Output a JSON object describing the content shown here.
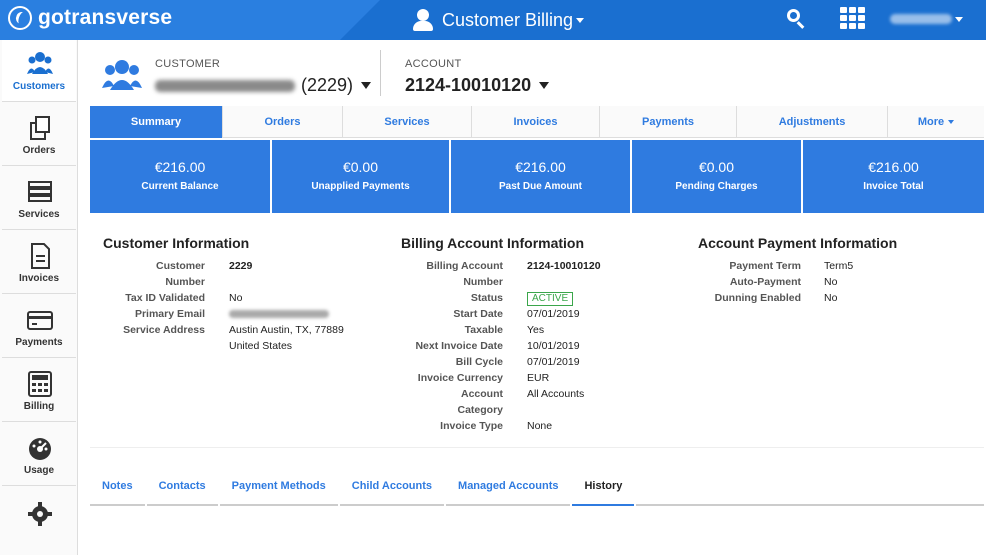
{
  "app": {
    "logo_text": "gotransverse",
    "title": "Customer Billing"
  },
  "topbar": {
    "search_icon": "search-icon",
    "apps_icon": "grid-icon"
  },
  "leftnav": {
    "items": [
      {
        "label": "Customers",
        "icon": "customers-icon"
      },
      {
        "label": "Orders",
        "icon": "orders-icon"
      },
      {
        "label": "Services",
        "icon": "services-icon"
      },
      {
        "label": "Invoices",
        "icon": "invoices-icon"
      },
      {
        "label": "Payments",
        "icon": "payments-icon"
      },
      {
        "label": "Billing",
        "icon": "billing-icon"
      },
      {
        "label": "Usage",
        "icon": "usage-icon"
      },
      {
        "label": "",
        "icon": "settings-icon"
      }
    ]
  },
  "header": {
    "customer_label": "CUSTOMER",
    "customer_id": "(2229)",
    "account_label": "ACCOUNT",
    "account_number": "2124-10010120"
  },
  "tabs": [
    "Summary",
    "Orders",
    "Services",
    "Invoices",
    "Payments",
    "Adjustments",
    "More"
  ],
  "summary": [
    {
      "amount": "€216.00",
      "label": "Current Balance"
    },
    {
      "amount": "€0.00",
      "label": "Unapplied Payments"
    },
    {
      "amount": "€216.00",
      "label": "Past Due Amount"
    },
    {
      "amount": "€0.00",
      "label": "Pending Charges"
    },
    {
      "amount": "€216.00",
      "label": "Invoice Total"
    }
  ],
  "customer_info": {
    "title": "Customer Information",
    "rows": [
      {
        "k": "Customer Number",
        "v": "2229"
      },
      {
        "k": "Tax ID Validated",
        "v": "No"
      },
      {
        "k": "Primary Email",
        "v": ""
      },
      {
        "k": "Service Address",
        "v": "Austin Austin, TX, 77889 United States"
      }
    ]
  },
  "billing_info": {
    "title": "Billing Account Information",
    "rows": [
      {
        "k": "Billing Account Number",
        "v": "2124-10010120"
      },
      {
        "k": "Status",
        "v": "ACTIVE"
      },
      {
        "k": "Start Date",
        "v": "07/01/2019"
      },
      {
        "k": "Taxable",
        "v": "Yes"
      },
      {
        "k": "Next Invoice Date",
        "v": "10/01/2019"
      },
      {
        "k": "Bill Cycle",
        "v": "07/01/2019"
      },
      {
        "k": "Invoice Currency",
        "v": "EUR"
      },
      {
        "k": "Account Category",
        "v": "All Accounts"
      },
      {
        "k": "Invoice Type",
        "v": "None"
      }
    ]
  },
  "payment_info": {
    "title": "Account Payment Information",
    "rows": [
      {
        "k": "Payment Term",
        "v": "Term5"
      },
      {
        "k": "Auto-Payment",
        "v": "No"
      },
      {
        "k": "Dunning Enabled",
        "v": "No"
      }
    ]
  },
  "bottom_tabs": [
    "Notes",
    "Contacts",
    "Payment Methods",
    "Child Accounts",
    "Managed Accounts",
    "History"
  ],
  "colors": {
    "primary": "#2f7be0",
    "topbar": "#1a6fd0",
    "active_badge": "#3aa64a"
  }
}
